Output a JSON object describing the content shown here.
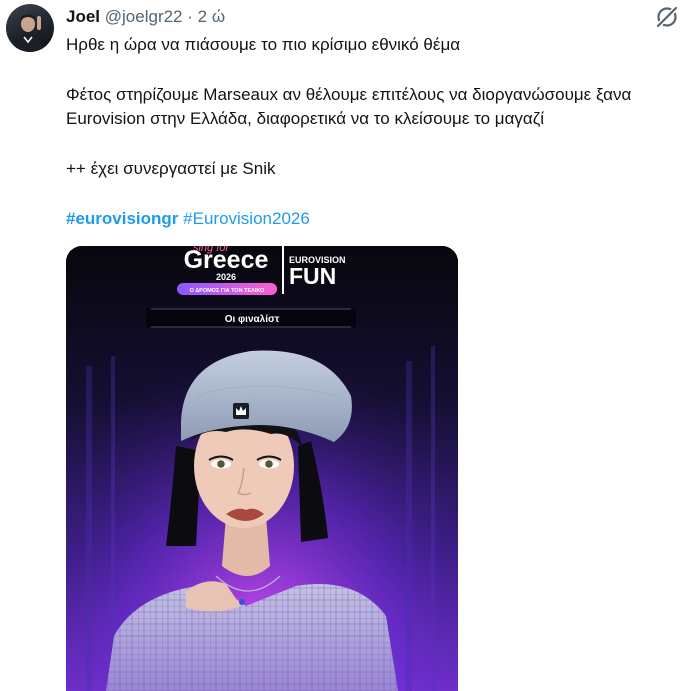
{
  "tweet": {
    "author_name": "Joel",
    "handle": "@joelgr22",
    "separator": "·",
    "time": "2 ώ",
    "lines": [
      "Ηρθε η ώρα να πιάσουμε το πιο κρίσιμο εθνικό θέμα",
      "Φέτος στηρίζουμε Marseaux αν θέλουμε επιτέλους να διοργανώσουμε ξανα",
      "Eurovision στην Ελλάδα, διαφορετικά να το κλείσουμε το μαγαζί",
      "++ έχει συνεργαστεί με Snik"
    ],
    "hashtags": [
      "#eurovisiongr",
      "#Eurovision2026"
    ]
  },
  "media": {
    "logo_small": "sing for",
    "logo_title": "Greece",
    "logo_year": "2026",
    "logo_pill": "Ο ΔΡΟΜΟΣ ΓΙΑ ΤΟΝ ΤΕΛΙΚΟ",
    "brand_top": "EUROVISION",
    "brand_bottom": "FUN",
    "banner": "Οι φιναλίστ"
  },
  "icons": {
    "grok": "grok-icon",
    "hat_logo": "crown-icon"
  },
  "colors": {
    "link": "#1d9bf0",
    "muted": "#536471",
    "text": "#0f1419"
  }
}
